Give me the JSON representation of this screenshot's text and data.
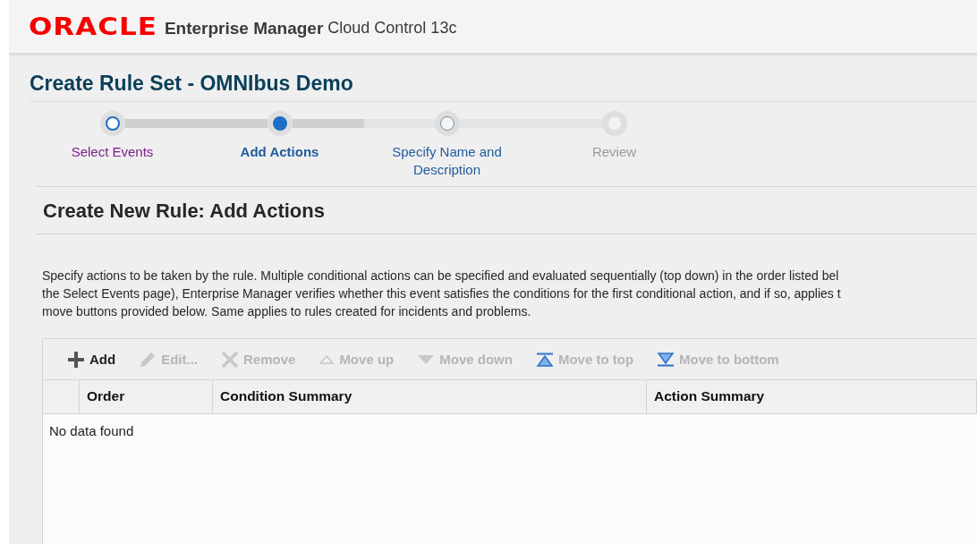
{
  "header": {
    "logo": "ORACLE",
    "product": "Enterprise Manager",
    "edition": "Cloud Control 13c"
  },
  "page_title": "Create Rule Set - OMNIbus Demo",
  "steps": [
    {
      "label": "Select Events",
      "selected": false,
      "visited": true,
      "disabled": false
    },
    {
      "label": "Add Actions",
      "selected": true,
      "visited": false,
      "disabled": false
    },
    {
      "label": "Specify Name and Description",
      "selected": false,
      "visited": false,
      "disabled": false
    },
    {
      "label": "Review",
      "selected": false,
      "visited": false,
      "disabled": true
    }
  ],
  "section_title": "Create New Rule: Add Actions",
  "description_lines": [
    "Specify actions to be taken by the rule. Multiple conditional actions can be specified and evaluated sequentially (top down) in the order listed bel",
    "the Select Events page), Enterprise Manager verifies whether this event satisfies the conditions for the first conditional action, and if so, applies t",
    "move buttons provided below. Same applies to rules created for incidents and problems."
  ],
  "toolbar": [
    {
      "label": "Add",
      "kind": "add",
      "disabled": false
    },
    {
      "label": "Edit...",
      "kind": "edit",
      "disabled": true
    },
    {
      "label": "Remove",
      "kind": "remove",
      "disabled": true
    },
    {
      "label": "Move up",
      "kind": "up",
      "disabled": true
    },
    {
      "label": "Move down",
      "kind": "down",
      "disabled": true
    },
    {
      "label": "Move to top",
      "kind": "top",
      "disabled": true
    },
    {
      "label": "Move to bottom",
      "kind": "bottom",
      "disabled": true
    }
  ],
  "table": {
    "columns": [
      "Order",
      "Condition Summary",
      "Action Summary"
    ],
    "empty_text": "No data found"
  }
}
